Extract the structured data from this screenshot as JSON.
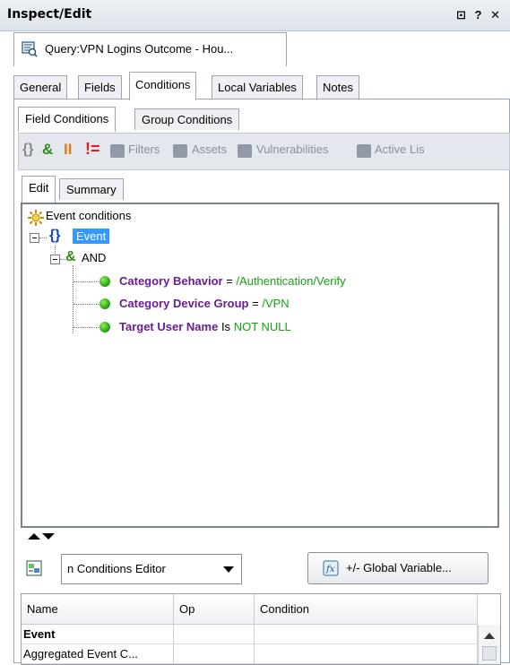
{
  "window": {
    "title": "Inspect/Edit",
    "controls": "⊡ ? ✕"
  },
  "query_tab": {
    "label": "Query:VPN Logins Outcome - Hou..."
  },
  "tabs": [
    {
      "label": "General"
    },
    {
      "label": "Fields"
    },
    {
      "label": "Conditions"
    },
    {
      "label": "Local Variables"
    },
    {
      "label": "Notes"
    }
  ],
  "sub_tabs": [
    {
      "label": "Field Conditions"
    },
    {
      "label": "Group Conditions"
    }
  ],
  "toolbar": {
    "filters": "Filters",
    "assets": "Assets",
    "vulnerabilities": "Vulnerabilities",
    "active_lists": "Active Lis"
  },
  "edit_tabs": [
    {
      "label": "Edit"
    },
    {
      "label": "Summary"
    }
  ],
  "tree": {
    "root": "Event conditions",
    "event": "Event",
    "and": "AND",
    "conditions": [
      {
        "field": "Category Behavior",
        "op": "=",
        "value": "/Authentication/Verify"
      },
      {
        "field": "Category Device Group",
        "op": "=",
        "value": "/VPN"
      },
      {
        "field": "Target User Name",
        "op": "Is",
        "value": "NOT NULL"
      }
    ]
  },
  "editor_select": {
    "value": "n Conditions Editor"
  },
  "global_variable_button": {
    "label": "+/- Global Variable..."
  },
  "table": {
    "columns": [
      "Name",
      "Op",
      "Condition"
    ],
    "rows": [
      {
        "name": "Event",
        "op": "",
        "condition": ""
      },
      {
        "name": "Aggregated Event C...",
        "op": "",
        "condition": ""
      }
    ]
  },
  "colors": {
    "field": "#6a1d8e",
    "value": "#16a016",
    "selection": "#3399ff"
  }
}
